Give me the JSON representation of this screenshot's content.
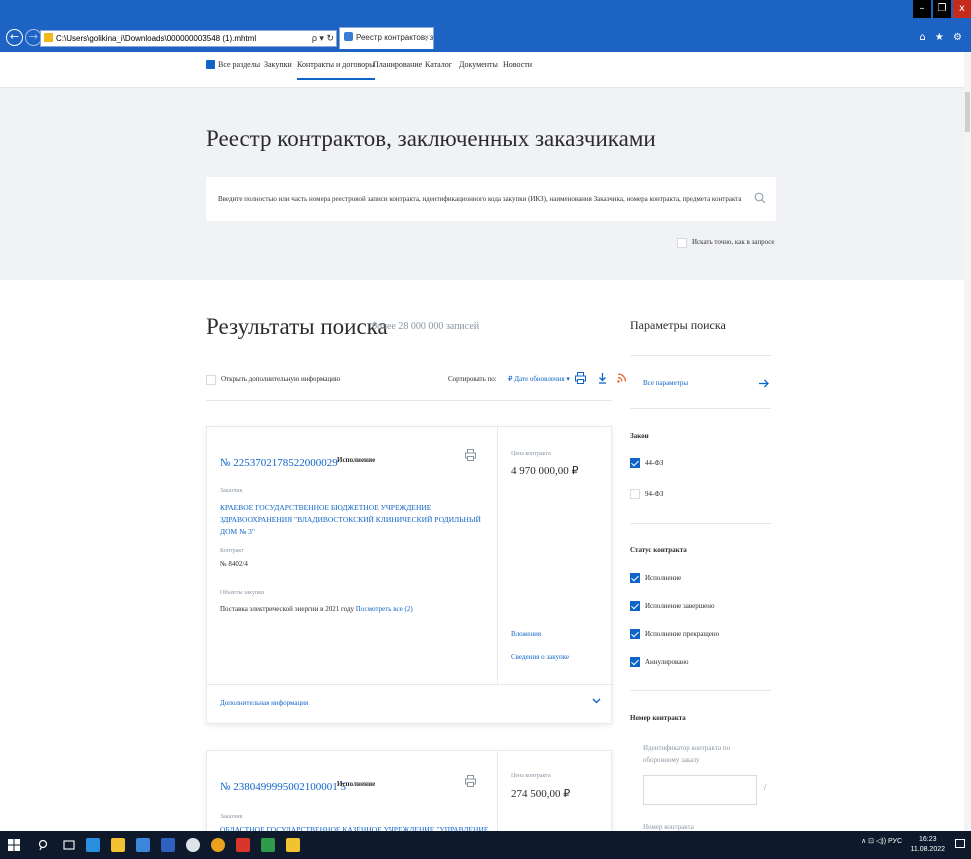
{
  "browser": {
    "address": "C:\\Users\\golikina_i\\Downloads\\000000003548 (1).mhtml",
    "address_tools": "ρ ▾ ↻",
    "tab_title": "Реестр контрактов, заклю...",
    "tab_close": "×",
    "back": "←",
    "forward": "→",
    "win_min": "–",
    "win_max": "❐",
    "win_close": "x",
    "tool_icons": "⌂ ★ ⚙"
  },
  "nav": {
    "items": [
      "Все разделы",
      "Закупки",
      "Контракты и договоры",
      "Планирование",
      "Каталог",
      "Документы",
      "Новости"
    ],
    "active_index": 2
  },
  "hero": {
    "title": "Реестр контрактов, заключенных заказчиками",
    "search_placeholder": "Введите полностью или часть номера реестровой записи контракта, идентификационного кода закупки (ИКЗ), наименования Заказчика, номера контракта, предмета контракта или наим",
    "exact_label": "Искать точно, как в запросе"
  },
  "results": {
    "title": "Результаты поиска",
    "count": "более 28 000 000 записей",
    "more_info_label": "Открыть дополнительную информацию",
    "sort_label": "Сортировать по:",
    "sort_value": "₽ Дате обновления ▾",
    "cards": [
      {
        "number": "№ 2253702178522000029",
        "status": "Исполнение",
        "customer_label": "Заказчик",
        "customer": "КРАЕВОЕ ГОСУДАРСТВЕННОЕ БЮДЖЕТНОЕ УЧРЕЖДЕНИЕ ЗДРАВООХРАНЕНИЯ \"ВЛАДИВОСТОКСКИЙ КЛИНИЧЕСКИЙ РОДИЛЬНЫЙ ДОМ № 3\"",
        "contract_label": "Контракт",
        "contract": "№ 8402/4",
        "objects_label": "Объекты закупки",
        "objects": "Поставка электрической энергии в 2021 году",
        "objects_link": "Посмотреть все (2)",
        "price_label": "Цена контракта",
        "price": "4 970 000,00 ₽",
        "attachments": "Вложения",
        "purchase_info": "Сведения о закупке",
        "footer": "Дополнительная информация"
      },
      {
        "number": "№ 2380499995002100001 5",
        "status": "Исполнение",
        "customer_label": "Заказчик",
        "customer": "ОБЛАСТНОЕ ГОСУДАРСТВЕННОЕ КАЗЕННОЕ УЧРЕЖДЕНИЕ \"УПРАВЛЕНИЕ",
        "price_label": "Цена контракта",
        "price": "274 500,00 ₽"
      }
    ]
  },
  "panel": {
    "title": "Параметры поиска",
    "all_params": "Все параметры",
    "law_heading": "Закон",
    "laws": [
      {
        "label": "44-ФЗ",
        "checked": true
      },
      {
        "label": "94-ФЗ",
        "checked": false
      }
    ],
    "status_heading": "Статус контракта",
    "statuses": [
      {
        "label": "Исполнение",
        "checked": true
      },
      {
        "label": "Исполнение завершено",
        "checked": true
      },
      {
        "label": "Исполнение прекращено",
        "checked": true
      },
      {
        "label": "Аннулировано",
        "checked": true
      }
    ],
    "number_heading": "Номер контракта",
    "defense_label": "Идентификатор контракта по оборонному заказу",
    "slash": "/",
    "contract_number_label": "Номер контракта"
  },
  "taskbar": {
    "tray": "∧ ⊡ ◁)) РУС",
    "time": "16:23",
    "date": "11.08.2022"
  },
  "colors": {
    "accent": "#0f64c8",
    "titlebar": "#1c63c3",
    "hero_bg": "#f0f2f5",
    "taskbar": "#0e1a2b"
  }
}
